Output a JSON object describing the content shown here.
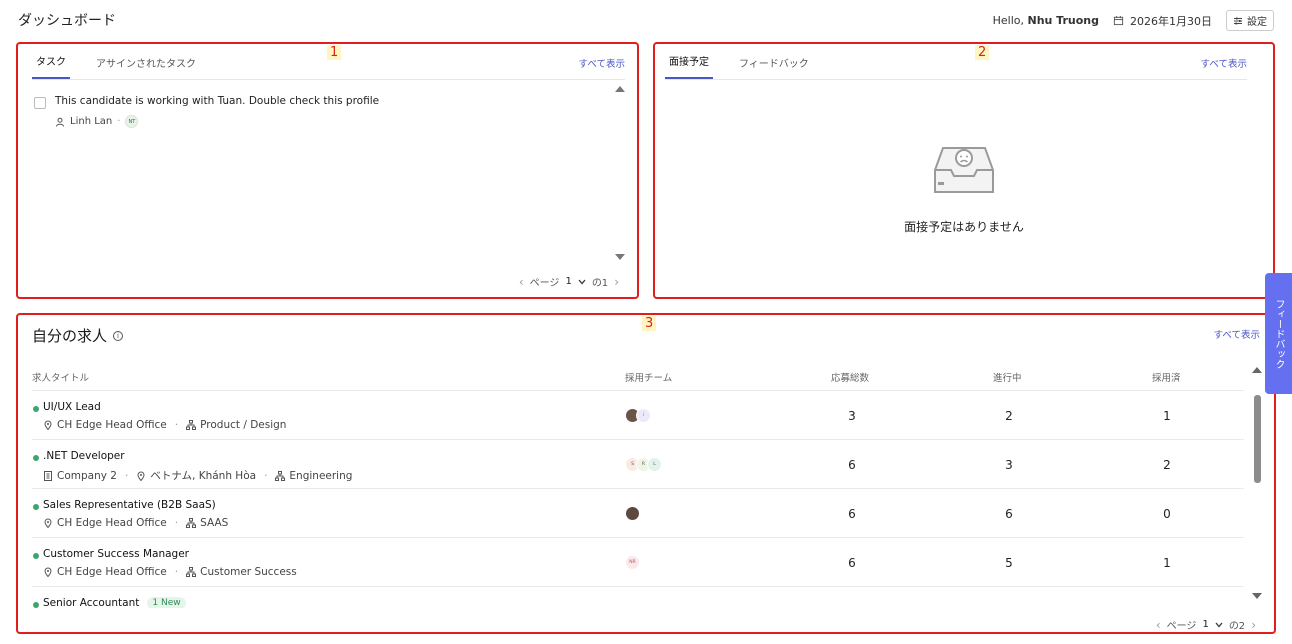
{
  "header": {
    "title": "ダッシュボード",
    "hello_prefix": "Hello, ",
    "user_name": "Nhu Truong",
    "date": "2026年1月30日",
    "settings_label": "設定"
  },
  "panel1": {
    "number": "1",
    "tabs": [
      {
        "label": "タスク"
      },
      {
        "label": "アサインされたタスク"
      }
    ],
    "see_all": "すべて表示",
    "task": {
      "text": "This candidate is working with Tuan. Double check this profile",
      "assignee": "Linh Lan",
      "avatar_initials": "NT"
    },
    "pager": {
      "label": "ページ",
      "page": "1",
      "of": "の1"
    }
  },
  "panel2": {
    "number": "2",
    "tabs": [
      {
        "label": "面接予定"
      },
      {
        "label": "フィードバック"
      }
    ],
    "see_all": "すべて表示",
    "empty_text": "面接予定はありません"
  },
  "panel3": {
    "number": "3",
    "title": "自分の求人",
    "info_icon": "i",
    "see_all": "すべて表示",
    "columns": [
      "求人タイトル",
      "採用チーム",
      "応募総数",
      "進行中",
      "採用済"
    ],
    "jobs": [
      {
        "title": "UI/UX Lead",
        "badge": "",
        "company": "",
        "location": "CH Edge Head Office",
        "department": "Product / Design",
        "team": [
          "",
          "i"
        ],
        "total": "3",
        "in_progress": "2",
        "hired": "1"
      },
      {
        "title": ".NET Developer",
        "badge": "",
        "company": "Company 2",
        "location": "ベトナム, Khánh Hòa",
        "department": "Engineering",
        "team": [
          "S",
          "R",
          "L"
        ],
        "total": "6",
        "in_progress": "3",
        "hired": "2"
      },
      {
        "title": "Sales Representative (B2B SaaS)",
        "badge": "",
        "company": "",
        "location": "CH Edge Head Office",
        "department": "SAAS",
        "team": [
          ""
        ],
        "total": "6",
        "in_progress": "6",
        "hired": "0"
      },
      {
        "title": "Customer Success Manager",
        "badge": "",
        "company": "",
        "location": "CH Edge Head Office",
        "department": "Customer Success",
        "team": [
          "NR"
        ],
        "total": "6",
        "in_progress": "5",
        "hired": "1"
      },
      {
        "title": "Senior Accountant",
        "badge": "1 New",
        "company": "",
        "location": "",
        "department": "",
        "team": [],
        "total": "",
        "in_progress": "",
        "hired": ""
      }
    ],
    "pager": {
      "label": "ページ",
      "page": "1",
      "of": "の2"
    }
  },
  "side_tab": {
    "label": "フィードバック"
  }
}
